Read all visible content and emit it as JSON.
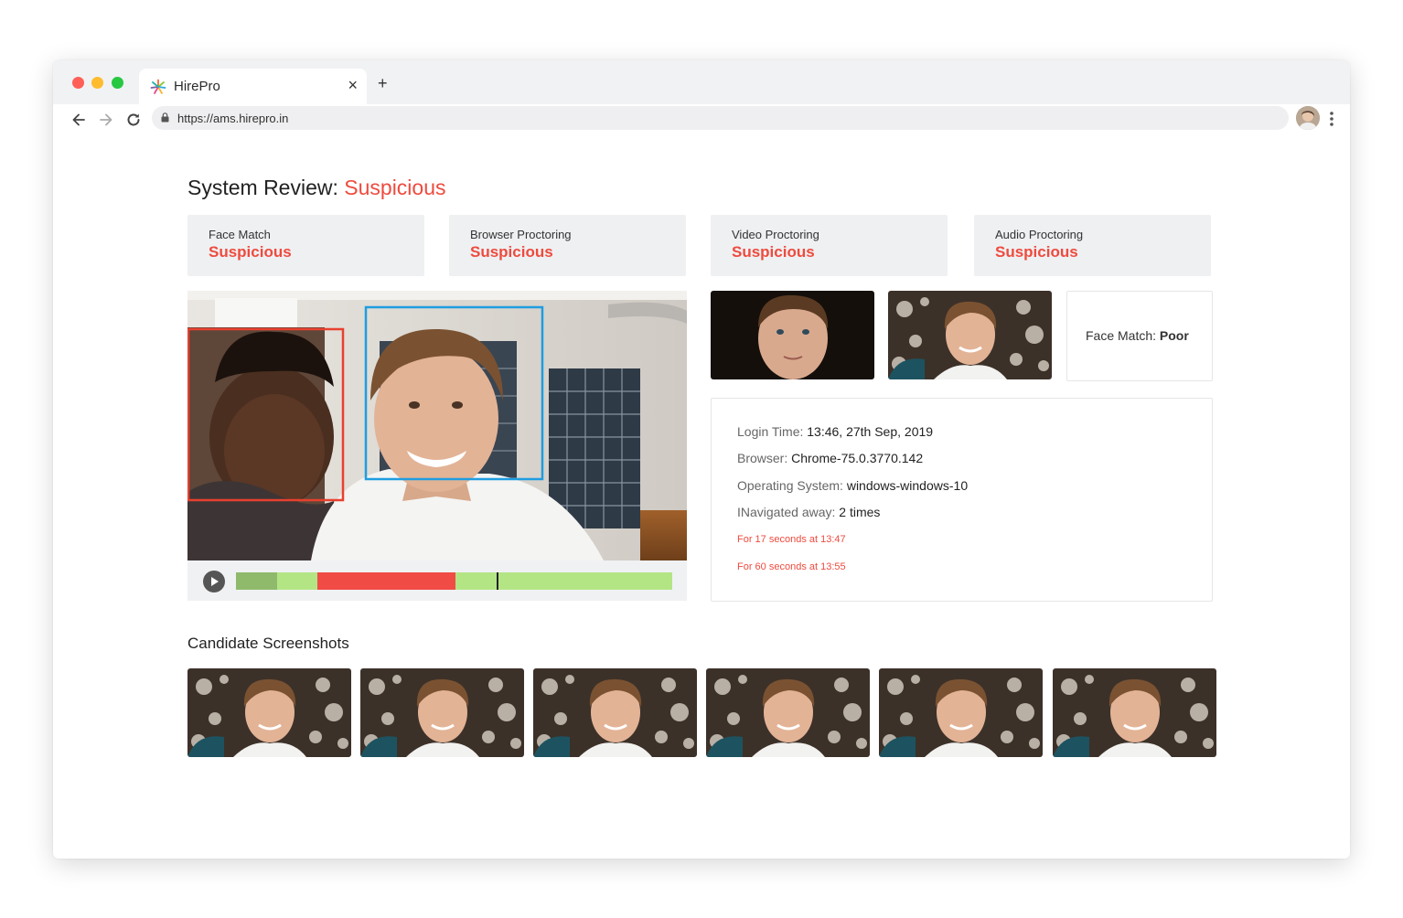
{
  "browser": {
    "tab_title": "HirePro",
    "tab_close": "×",
    "new_tab": "+",
    "url": "https://ams.hirepro.in",
    "colors": {
      "close": "#fe5f57",
      "minimize": "#febc2e",
      "maximize": "#28c840"
    }
  },
  "page": {
    "title_label": "System Review: ",
    "title_status": "Suspicious",
    "cards": [
      {
        "label": "Face Match",
        "value": "Suspicious"
      },
      {
        "label": "Browser Proctoring",
        "value": "Suspicious"
      },
      {
        "label": "Video Proctoring",
        "value": "Suspicious"
      },
      {
        "label": "Audio Proctoring",
        "value": "Suspicious"
      }
    ],
    "face_match": {
      "label": "Face Match: ",
      "value": "Poor"
    },
    "info": {
      "login_label": "Login Time: ",
      "login_value": "13:46, 27th Sep, 2019",
      "browser_label": "Browser: ",
      "browser_value": "Chrome-75.0.3770.142",
      "os_label": "Operating System: ",
      "os_value": "windows-windows-10",
      "nav_label": "INavigated away: ",
      "nav_value": "2 times",
      "events": [
        "For 17 seconds at 13:47",
        "For 60 seconds at 13:55"
      ]
    },
    "screenshots_title": "Candidate Screenshots"
  },
  "icons": [
    "hirepro-logo-icon",
    "close-icon",
    "plus-icon",
    "back-arrow-icon",
    "forward-arrow-icon",
    "reload-icon",
    "lock-icon",
    "user-avatar",
    "more-vert-icon",
    "play-icon"
  ],
  "colors": {
    "accent_red": "#ee4b3e",
    "timeline_green": "#b4e585",
    "timeline_dark_green": "#8fba6b",
    "timeline_red": "#f14b46",
    "face_box_blue": "#1f9de0",
    "face_box_red": "#e8402f"
  }
}
